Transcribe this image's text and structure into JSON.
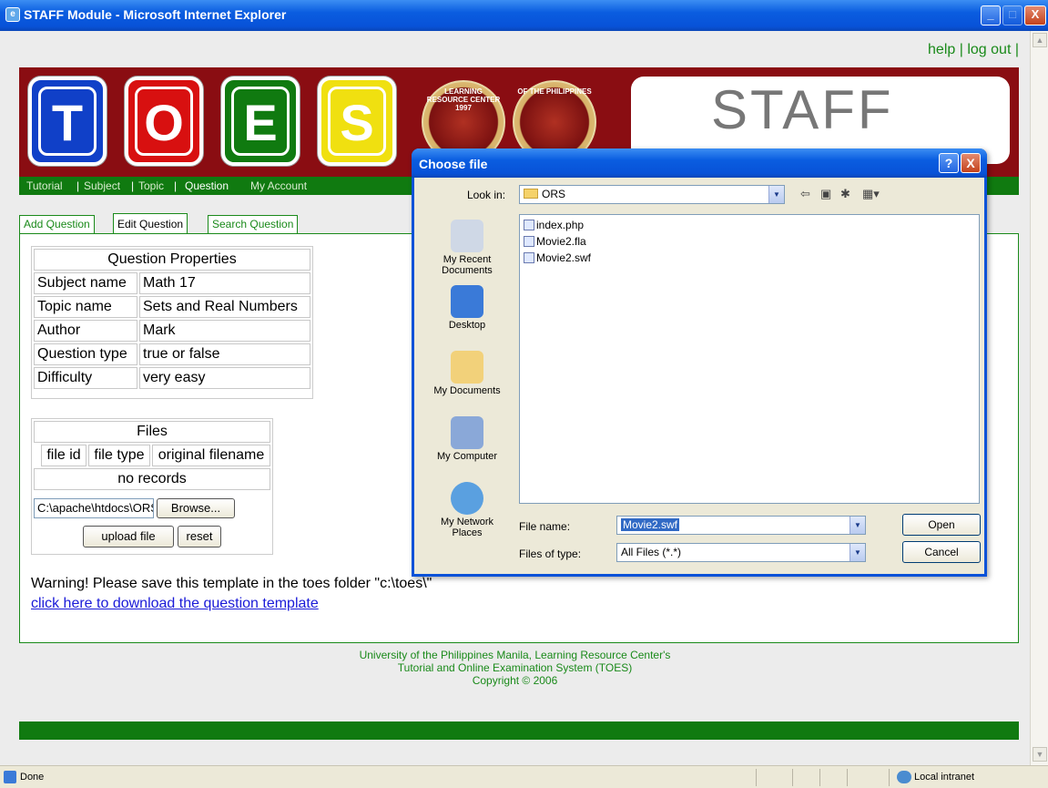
{
  "window": {
    "title": "STAFF Module - Microsoft Internet Explorer",
    "min_label": "_",
    "max_label": "□",
    "close_label": "X"
  },
  "header": {
    "help_link": "help",
    "logout_link": "log out",
    "logo_letters": [
      "T",
      "O",
      "E",
      "S"
    ],
    "logo_colors": [
      "#1040c8",
      "#d81010",
      "#107a10",
      "#f0e010"
    ],
    "staff_label": "STAFF",
    "seal1_text": "LEARNING RESOURCE CENTER 1997",
    "seal2_text": "OF THE PHILIPPINES"
  },
  "nav": {
    "items": [
      "Tutorial",
      "Subject",
      "Topic",
      "Question",
      "My Account"
    ],
    "active": "Question"
  },
  "tabs": [
    "Add Question",
    "Edit Question",
    "Search Question"
  ],
  "question_properties": {
    "title": "Question Properties",
    "rows": [
      {
        "label": "Subject name",
        "value": "Math 17"
      },
      {
        "label": "Topic name",
        "value": "Sets and Real Numbers"
      },
      {
        "label": "Author",
        "value": "Mark"
      },
      {
        "label": "Question type",
        "value": "true or false"
      },
      {
        "label": "Difficulty",
        "value": "very easy"
      }
    ]
  },
  "files": {
    "title": "Files",
    "columns": [
      "file id",
      "file type",
      "original filename"
    ],
    "empty": "no records",
    "path_value": "C:\\apache\\htdocs\\ORS\\",
    "browse_label": "Browse...",
    "upload_label": "upload file",
    "reset_label": "reset"
  },
  "warning": "Warning! Please save this template in the toes folder \"c:\\toes\\\"",
  "download_link": "click here to download the question template",
  "footer": {
    "line1": "University of the Philippines Manila, Learning Resource Center's",
    "line2": "Tutorial and Online Examination System (TOES)",
    "line3": "Copyright © 2006"
  },
  "statusbar": {
    "status": "Done",
    "zone": "Local intranet"
  },
  "dialog": {
    "title": "Choose file",
    "help_label": "?",
    "close_label": "X",
    "look_in_label": "Look in:",
    "look_in_value": "ORS",
    "places": [
      "My Recent Documents",
      "Desktop",
      "My Documents",
      "My Computer",
      "My Network Places"
    ],
    "files": [
      "index.php",
      "Movie2.fla",
      "Movie2.swf"
    ],
    "file_name_label": "File name:",
    "file_name_value": "Movie2.swf",
    "files_of_type_label": "Files of type:",
    "files_of_type_value": "All Files (*.*)",
    "open_label": "Open",
    "cancel_label": "Cancel"
  }
}
